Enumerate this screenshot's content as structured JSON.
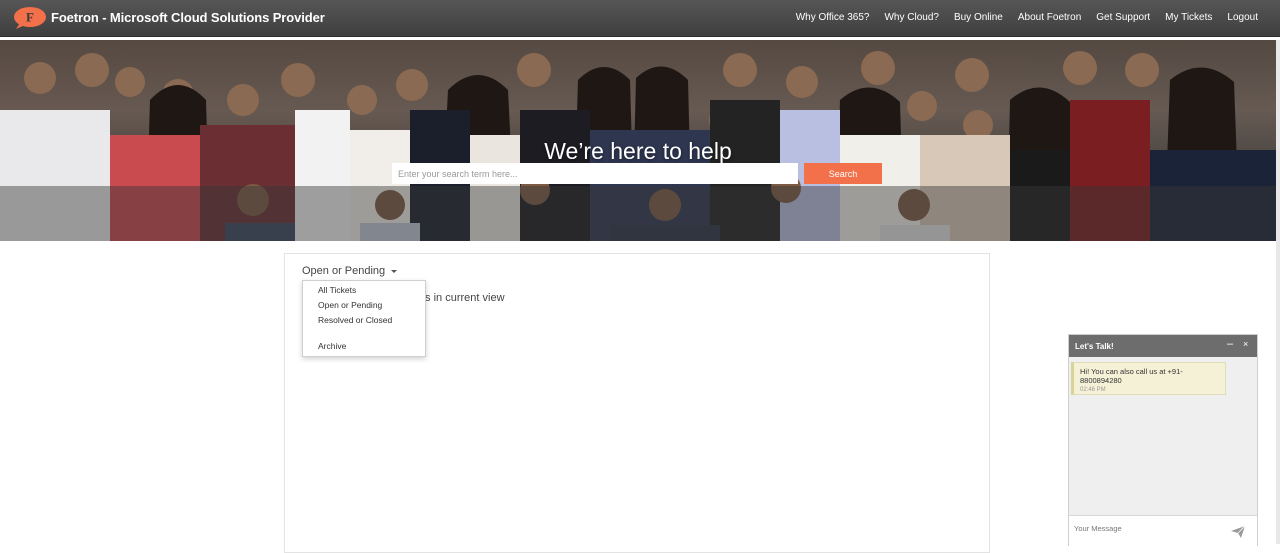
{
  "brand": {
    "logo_letter": "F",
    "title": "Foetron - Microsoft Cloud Solutions Provider",
    "logo_color": "#f2704a"
  },
  "nav": {
    "items": [
      "Why Office 365?",
      "Why Cloud?",
      "Buy Online",
      "About Foetron",
      "Get Support",
      "My Tickets",
      "Logout"
    ]
  },
  "hero": {
    "title": "We’re here to help",
    "search_placeholder": "Enter your search term here...",
    "search_button": "Search",
    "accent_color": "#f2704a"
  },
  "tickets": {
    "filter_label": "Open or Pending",
    "empty_message_suffix": "ts in current view",
    "dropdown_options": [
      "All Tickets",
      "Open or Pending",
      "Resolved or Closed",
      "Archive"
    ]
  },
  "chat": {
    "title": "Let's Talk!",
    "minimize_symbol": "–",
    "close_symbol": "×",
    "message_text": "Hi! You can also call us at +91-8800894280",
    "message_time": "02:46 PM",
    "input_placeholder": "Your Message"
  },
  "icons": {
    "logo": "speech-bubble-logo-icon",
    "caret": "caret-down-icon",
    "send": "paper-plane-icon"
  }
}
